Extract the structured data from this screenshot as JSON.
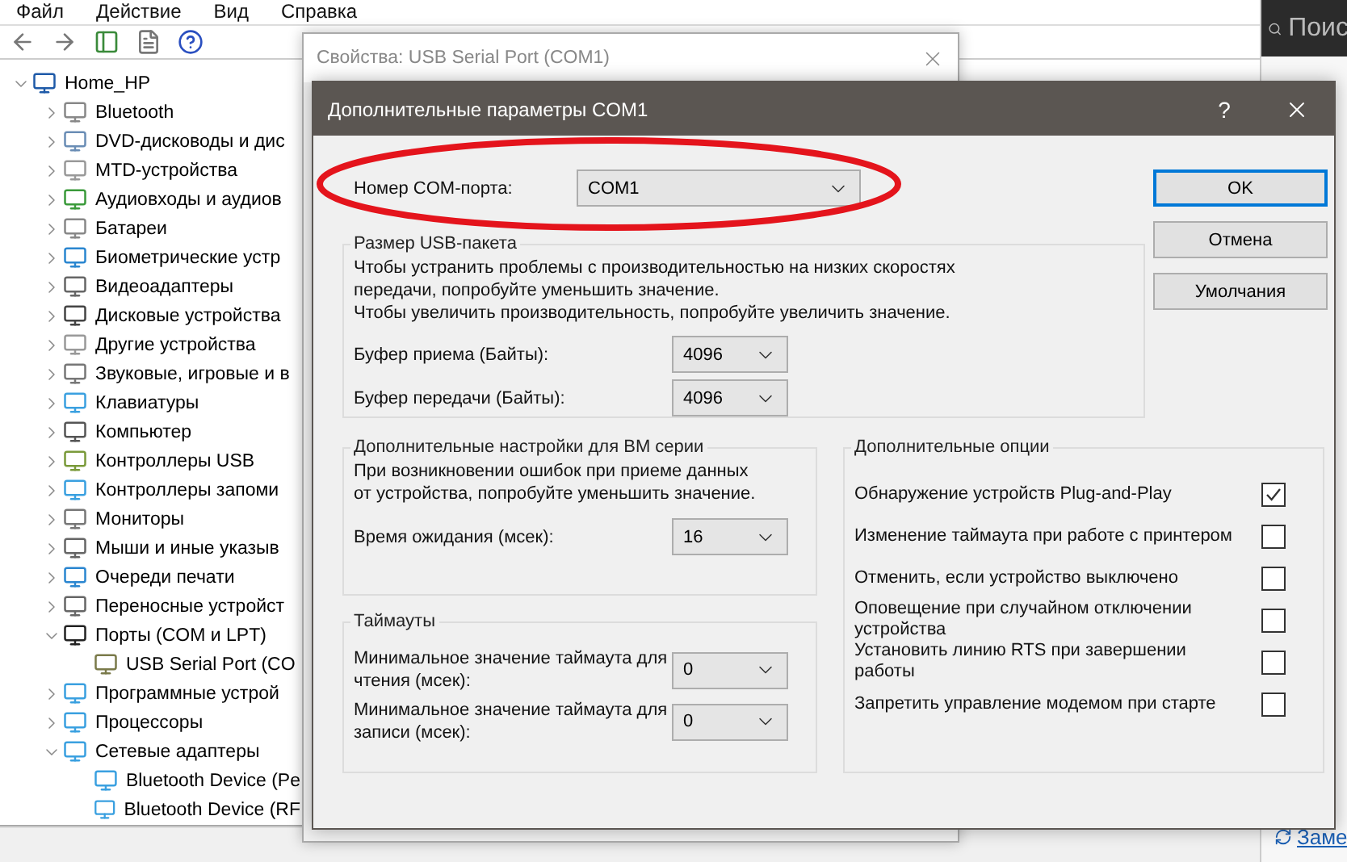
{
  "device_manager": {
    "menu": [
      "Файл",
      "Действие",
      "Вид",
      "Справка"
    ],
    "tree": {
      "label": "Home_HP",
      "expanded": true,
      "children": [
        {
          "label": "Bluetooth",
          "expanded": false
        },
        {
          "label": "DVD-дисководы и дис",
          "expanded": false
        },
        {
          "label": "MTD-устройства",
          "expanded": false
        },
        {
          "label": "Аудиовходы и аудиов",
          "expanded": false
        },
        {
          "label": "Батареи",
          "expanded": false
        },
        {
          "label": "Биометрические устр",
          "expanded": false
        },
        {
          "label": "Видеоадаптеры",
          "expanded": false
        },
        {
          "label": "Дисковые устройства",
          "expanded": false
        },
        {
          "label": "Другие устройства",
          "expanded": false
        },
        {
          "label": "Звуковые, игровые и в",
          "expanded": false
        },
        {
          "label": "Клавиатуры",
          "expanded": false
        },
        {
          "label": "Компьютер",
          "expanded": false
        },
        {
          "label": "Контроллеры USB",
          "expanded": false
        },
        {
          "label": "Контроллеры запоми",
          "expanded": false
        },
        {
          "label": "Мониторы",
          "expanded": false
        },
        {
          "label": "Мыши и иные указыв",
          "expanded": false
        },
        {
          "label": "Очереди печати",
          "expanded": false
        },
        {
          "label": "Переносные устройст",
          "expanded": false
        },
        {
          "label": "Порты (COM и LPT)",
          "expanded": true,
          "children": [
            {
              "label": "USB Serial Port (CO"
            }
          ]
        },
        {
          "label": "Программные устрой",
          "expanded": false
        },
        {
          "label": "Процессоры",
          "expanded": false
        },
        {
          "label": "Сетевые адаптеры",
          "expanded": true,
          "children": [
            {
              "label": "Bluetooth Device (Pe"
            },
            {
              "label": "Bluetooth Device (RF"
            }
          ]
        }
      ]
    }
  },
  "side_panel": {
    "search_placeholder": "Поис",
    "link": "Заме"
  },
  "properties_window": {
    "title": "Свойства: USB Serial Port (COM1)"
  },
  "dialog": {
    "title": "Дополнительные параметры COM1",
    "help": "?",
    "com_port": {
      "label": "Номер COM-порта:",
      "value": "COM1"
    },
    "buttons": [
      {
        "label": "OK",
        "default": true
      },
      {
        "label": "Отмена",
        "default": false
      },
      {
        "label": "Умолчания",
        "default": false
      }
    ],
    "usb_group": {
      "title": "Размер USB-пакета",
      "notes": [
        "Чтобы устранить проблемы с производительностью на низких скоростях передачи, попробуйте уменьшить значение.",
        "Чтобы увеличить производительность, попробуйте увеличить значение."
      ],
      "fields": [
        {
          "label": "Буфер приема (Байты):",
          "value": "4096"
        },
        {
          "label": "Буфер передачи (Байты):",
          "value": "4096"
        }
      ]
    },
    "bm_group": {
      "title": "Дополнительные настройки для ВМ серии",
      "note": "При возникновении ошибок при приеме данных от устройства, попробуйте уменьшить значение.",
      "fields": [
        {
          "label": "Время ожидания (мсек):",
          "value": "16"
        }
      ]
    },
    "timeouts": {
      "title": "Таймауты",
      "fields": [
        {
          "label": "Минимальное значение таймаута для чтения (мсек):",
          "value": "0"
        },
        {
          "label": "Минимальное значение таймаута для записи (мсек):",
          "value": "0"
        }
      ]
    },
    "options": {
      "title": "Дополнительные опции",
      "items": [
        {
          "label": "Обнаружение устройств Plug-and-Play",
          "checked": true
        },
        {
          "label": "Изменение таймаута при работе с принтером",
          "checked": false
        },
        {
          "label": "Отменить, если устройство выключено",
          "checked": false
        },
        {
          "label": "Оповещение при случайном отключении устройства",
          "checked": false
        },
        {
          "label": "Установить линию RTS при завершении работы",
          "checked": false
        },
        {
          "label": "Запретить управление модемом при старте",
          "checked": false
        }
      ]
    }
  }
}
